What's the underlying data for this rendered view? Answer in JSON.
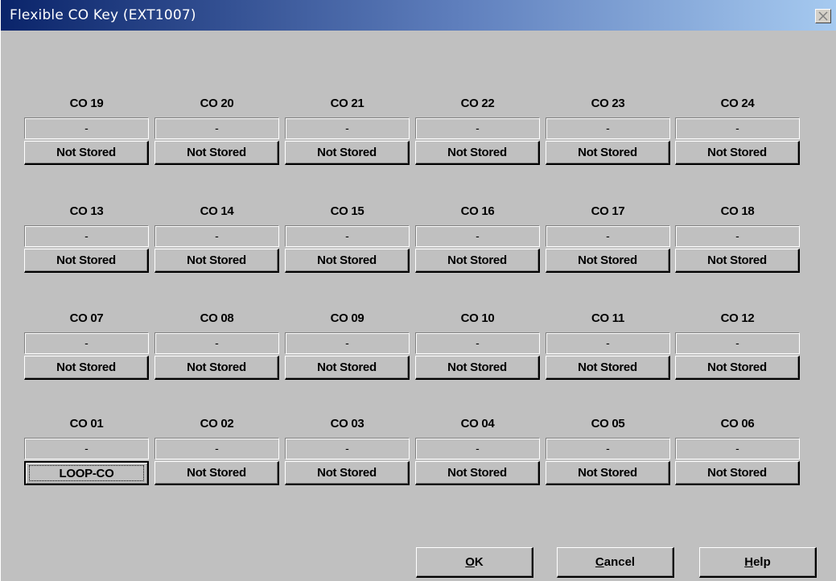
{
  "window": {
    "title": "Flexible CO Key (EXT1007)"
  },
  "grid": {
    "rows": [
      [
        {
          "label": "CO 19",
          "value": "-",
          "button": "Not Stored"
        },
        {
          "label": "CO 20",
          "value": "-",
          "button": "Not Stored"
        },
        {
          "label": "CO 21",
          "value": "-",
          "button": "Not Stored"
        },
        {
          "label": "CO 22",
          "value": "-",
          "button": "Not Stored"
        },
        {
          "label": "CO 23",
          "value": "-",
          "button": "Not Stored"
        },
        {
          "label": "CO 24",
          "value": "-",
          "button": "Not Stored"
        }
      ],
      [
        {
          "label": "CO 13",
          "value": "-",
          "button": "Not Stored"
        },
        {
          "label": "CO 14",
          "value": "-",
          "button": "Not Stored"
        },
        {
          "label": "CO 15",
          "value": "-",
          "button": "Not Stored"
        },
        {
          "label": "CO 16",
          "value": "-",
          "button": "Not Stored"
        },
        {
          "label": "CO 17",
          "value": "-",
          "button": "Not Stored"
        },
        {
          "label": "CO 18",
          "value": "-",
          "button": "Not Stored"
        }
      ],
      [
        {
          "label": "CO 07",
          "value": "-",
          "button": "Not Stored"
        },
        {
          "label": "CO 08",
          "value": "-",
          "button": "Not Stored"
        },
        {
          "label": "CO 09",
          "value": "-",
          "button": "Not Stored"
        },
        {
          "label": "CO 10",
          "value": "-",
          "button": "Not Stored"
        },
        {
          "label": "CO 11",
          "value": "-",
          "button": "Not Stored"
        },
        {
          "label": "CO 12",
          "value": "-",
          "button": "Not Stored"
        }
      ],
      [
        {
          "label": "CO 01",
          "value": "-",
          "button": "LOOP-CO",
          "focused": true
        },
        {
          "label": "CO 02",
          "value": "-",
          "button": "Not Stored"
        },
        {
          "label": "CO 03",
          "value": "-",
          "button": "Not Stored"
        },
        {
          "label": "CO 04",
          "value": "-",
          "button": "Not Stored"
        },
        {
          "label": "CO 05",
          "value": "-",
          "button": "Not Stored"
        },
        {
          "label": "CO 06",
          "value": "-",
          "button": "Not Stored"
        }
      ]
    ]
  },
  "buttons": {
    "ok": {
      "mnemonic": "O",
      "rest": "K"
    },
    "cancel": {
      "mnemonic": "C",
      "rest": "ancel"
    },
    "help": {
      "mnemonic": "H",
      "rest": "elp"
    }
  },
  "icons": {
    "close": "close-icon"
  },
  "colors": {
    "face": "#c0c0c0",
    "title_start": "#0a246a",
    "title_end": "#a6caf0"
  }
}
